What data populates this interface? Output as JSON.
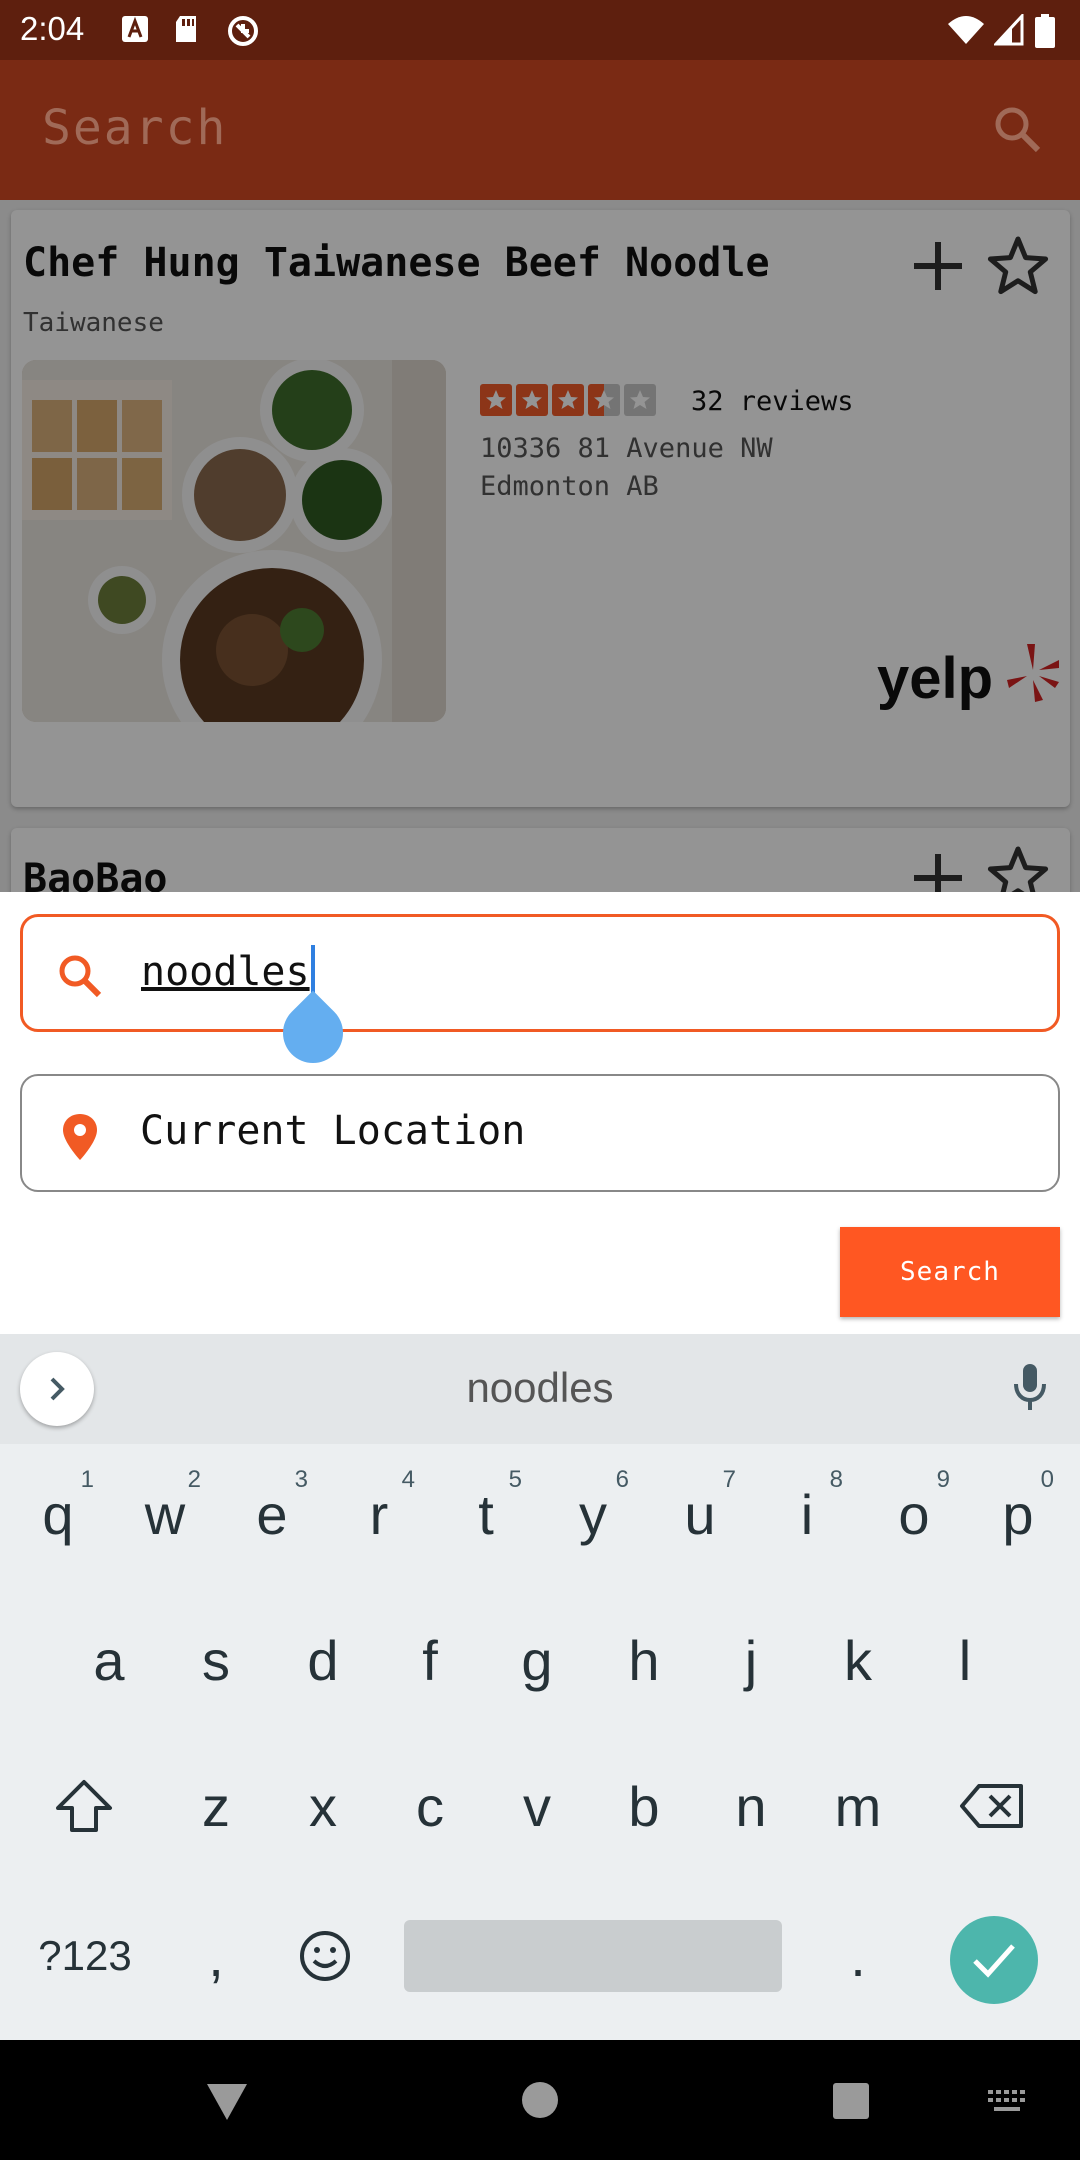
{
  "status_bar": {
    "time": "2:04"
  },
  "app_bar": {
    "title": "Search"
  },
  "results": [
    {
      "name": "Chef Hung Taiwanese Beef Noodle",
      "category": "Taiwanese",
      "rating": 3.5,
      "reviews": "32 reviews",
      "address_line1": "10336 81 Avenue NW",
      "address_line2": "Edmonton AB",
      "source": "yelp"
    },
    {
      "name": "BaoBao"
    }
  ],
  "search_form": {
    "query_value": "noodles",
    "location_value": "Current Location",
    "search_button": "Search"
  },
  "keyboard": {
    "suggestion": "noodles",
    "row1": [
      "q",
      "w",
      "e",
      "r",
      "t",
      "y",
      "u",
      "i",
      "o",
      "p"
    ],
    "row1_hints": [
      "1",
      "2",
      "3",
      "4",
      "5",
      "6",
      "7",
      "8",
      "9",
      "0"
    ],
    "row2": [
      "a",
      "s",
      "d",
      "f",
      "g",
      "h",
      "j",
      "k",
      "l"
    ],
    "row3": [
      "z",
      "x",
      "c",
      "v",
      "b",
      "n",
      "m"
    ],
    "symbols_key": "?123",
    "comma_key": ",",
    "period_key": "."
  },
  "colors": {
    "accent": "#ff5722",
    "app_bar": "#7a2a14",
    "status_bar": "#5e1f0e",
    "enter_key": "#4db6ac"
  }
}
